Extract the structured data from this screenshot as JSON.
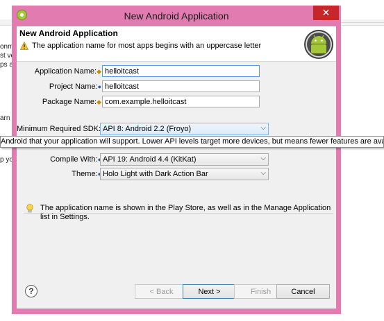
{
  "background": {
    "fragments": [
      "onme",
      "st ve",
      "ps a",
      "arn t",
      "p yo"
    ]
  },
  "window": {
    "title": "New Android Application",
    "close_glyph": "✕"
  },
  "header": {
    "title": "New Android Application",
    "message": "The application name for most apps begins with an uppercase letter",
    "warning_icon": "warning-triangle-icon"
  },
  "form": {
    "application_name": {
      "label": "Application Name:",
      "value": "helloitcast"
    },
    "project_name": {
      "label": "Project Name:",
      "value": "helloitcast"
    },
    "package_name": {
      "label": "Package Name:",
      "value": "com.example.helloitcast"
    },
    "min_sdk": {
      "label": "Minimum Required SDK:",
      "value": "API 8: Android 2.2 (Froyo)"
    },
    "compile_with": {
      "label": "Compile With:",
      "value": "API 19: Android 4.4 (KitKat)"
    },
    "theme": {
      "label": "Theme:",
      "value": "Holo Light with Dark Action Bar"
    }
  },
  "tooltip": {
    "text": "Android that your application will support. Lower API levels target more devices, but means fewer features are available. By tar"
  },
  "info": {
    "text": "The application name is shown in the Play Store, as well as in the Manage Application list in Settings."
  },
  "buttons": {
    "back": "< Back",
    "next": "Next >",
    "finish": "Finish",
    "cancel": "Cancel",
    "help": "?"
  },
  "colors": {
    "frame": "#e17bb0",
    "close": "#c7262b",
    "android_green": "#a4c639"
  }
}
